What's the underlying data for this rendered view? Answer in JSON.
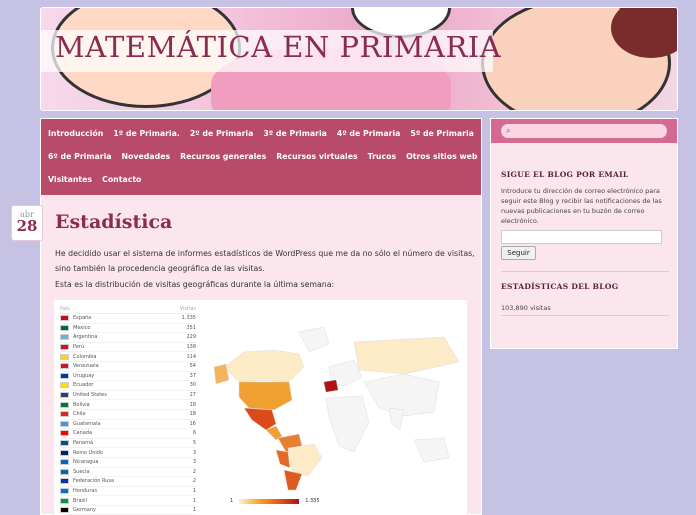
{
  "site": {
    "title": "MATEMÁTICA EN PRIMARIA"
  },
  "nav": {
    "row1": [
      "Introducción",
      "1º de Primaria.",
      "2º de Primaria",
      "3º de Primaria",
      "4º de Primaria",
      "5º de Primaria"
    ],
    "row2": [
      "6º de Primaria",
      "Novedades",
      "Recursos generales",
      "Recursos virtuales",
      "Trucos",
      "Otros sitios web"
    ],
    "row3": [
      "Visitantes",
      "Contacto"
    ]
  },
  "post": {
    "date_month": "abr",
    "date_day": "28",
    "title": "Estadística",
    "paragraph1": "He decidido usar el sistema de informes estadísticos de WordPress que me da no sólo el número de visitas, sino también la procedencia geográfica de las visitas.",
    "paragraph2": "Esta es la distribución de visitas geográficas durante la última semana:"
  },
  "stats_table": {
    "header_country": "País",
    "header_visits": "Visitas",
    "rows": [
      {
        "country": "España",
        "visits": "1.335",
        "color": "#c60b1e"
      },
      {
        "country": "Mexico",
        "visits": "351",
        "color": "#006847"
      },
      {
        "country": "Argentina",
        "visits": "229",
        "color": "#74acdf"
      },
      {
        "country": "Perú",
        "visits": "138",
        "color": "#d91023"
      },
      {
        "country": "Colombia",
        "visits": "114",
        "color": "#fcd116"
      },
      {
        "country": "Venezuela",
        "visits": "54",
        "color": "#cf142b"
      },
      {
        "country": "Uruguay",
        "visits": "37",
        "color": "#0038a8"
      },
      {
        "country": "Ecuador",
        "visits": "30",
        "color": "#ffdd00"
      },
      {
        "country": "United States",
        "visits": "27",
        "color": "#3c3b6e"
      },
      {
        "country": "Bolivia",
        "visits": "18",
        "color": "#007934"
      },
      {
        "country": "Chile",
        "visits": "18",
        "color": "#d52b1e"
      },
      {
        "country": "Guatemala",
        "visits": "16",
        "color": "#4997d0"
      },
      {
        "country": "Canada",
        "visits": "6",
        "color": "#ff0000"
      },
      {
        "country": "Panamá",
        "visits": "5",
        "color": "#005293"
      },
      {
        "country": "Reino Unido",
        "visits": "3",
        "color": "#012169"
      },
      {
        "country": "Nicaragua",
        "visits": "3",
        "color": "#0067c6"
      },
      {
        "country": "Suecia",
        "visits": "2",
        "color": "#006aa7"
      },
      {
        "country": "Federación Rusa",
        "visits": "2",
        "color": "#0039a6"
      },
      {
        "country": "Honduras",
        "visits": "1",
        "color": "#0073cf"
      },
      {
        "country": "Brazil",
        "visits": "1",
        "color": "#009c3b"
      },
      {
        "country": "Germany",
        "visits": "1",
        "color": "#000000"
      }
    ]
  },
  "legend": {
    "min": "1",
    "max": "1.335"
  },
  "sidebar": {
    "search_placeholder": "",
    "follow_title": "SIGUE EL BLOG POR EMAIL",
    "follow_text": "Introduce tu dirección de correo electrónico para seguir este Blog y recibir las notificaciones de las nuevas publicaciones en tu buzón de correo electrónico.",
    "email_value": "",
    "follow_button": "Seguir",
    "stats_title": "ESTADÍSTICAS DEL BLOG",
    "stats_value": "103,890 visitas"
  },
  "colors": {
    "accent": "#b84a6a",
    "title": "#8b2b52",
    "background": "#c5c2e4"
  }
}
